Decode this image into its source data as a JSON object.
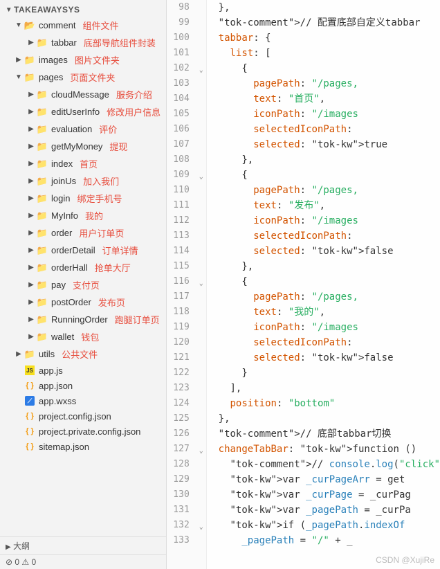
{
  "project_name": "TAKEAWAYSYS",
  "tree": [
    {
      "depth": 1,
      "expand": "open",
      "icon": "folder-open",
      "label": "comment",
      "annotation": "组件文件"
    },
    {
      "depth": 2,
      "expand": "closed",
      "icon": "folder",
      "label": "tabbar",
      "annotation": "底部导航组件封装"
    },
    {
      "depth": 1,
      "expand": "closed",
      "icon": "folder-green",
      "label": "images",
      "annotation": "图片文件夹"
    },
    {
      "depth": 1,
      "expand": "open",
      "icon": "folder-orange",
      "label": "pages",
      "annotation": "页面文件夹"
    },
    {
      "depth": 2,
      "expand": "closed",
      "icon": "folder",
      "label": "cloudMessage",
      "annotation": "服务介绍"
    },
    {
      "depth": 2,
      "expand": "closed",
      "icon": "folder",
      "label": "editUserInfo",
      "annotation": "修改用户信息"
    },
    {
      "depth": 2,
      "expand": "closed",
      "icon": "folder",
      "label": "evaluation",
      "annotation": "评价"
    },
    {
      "depth": 2,
      "expand": "closed",
      "icon": "folder",
      "label": "getMyMoney",
      "annotation": "提现"
    },
    {
      "depth": 2,
      "expand": "closed",
      "icon": "folder",
      "label": "index",
      "annotation": "首页"
    },
    {
      "depth": 2,
      "expand": "closed",
      "icon": "folder",
      "label": "joinUs",
      "annotation": "加入我们"
    },
    {
      "depth": 2,
      "expand": "closed",
      "icon": "folder",
      "label": "login",
      "annotation": "绑定手机号"
    },
    {
      "depth": 2,
      "expand": "closed",
      "icon": "folder",
      "label": "MyInfo",
      "annotation": "我的"
    },
    {
      "depth": 2,
      "expand": "closed",
      "icon": "folder",
      "label": "order",
      "annotation": "用户订单页"
    },
    {
      "depth": 2,
      "expand": "closed",
      "icon": "folder",
      "label": "orderDetail",
      "annotation": "订单详情"
    },
    {
      "depth": 2,
      "expand": "closed",
      "icon": "folder",
      "label": "orderHall",
      "annotation": "抢单大厅"
    },
    {
      "depth": 2,
      "expand": "closed",
      "icon": "folder",
      "label": "pay",
      "annotation": "支付页"
    },
    {
      "depth": 2,
      "expand": "closed",
      "icon": "folder",
      "label": "postOrder",
      "annotation": "发布页"
    },
    {
      "depth": 2,
      "expand": "closed",
      "icon": "folder",
      "label": "RunningOrder",
      "annotation": "跑腿订单页"
    },
    {
      "depth": 2,
      "expand": "closed",
      "icon": "folder",
      "label": "wallet",
      "annotation": "钱包"
    },
    {
      "depth": 1,
      "expand": "closed",
      "icon": "folder-purple",
      "label": "utils",
      "annotation": "公共文件"
    },
    {
      "depth": 1,
      "expand": "",
      "icon": "js",
      "label": "app.js",
      "annotation": ""
    },
    {
      "depth": 1,
      "expand": "",
      "icon": "json",
      "label": "app.json",
      "annotation": ""
    },
    {
      "depth": 1,
      "expand": "",
      "icon": "wxss",
      "label": "app.wxss",
      "annotation": ""
    },
    {
      "depth": 1,
      "expand": "",
      "icon": "json",
      "label": "project.config.json",
      "annotation": ""
    },
    {
      "depth": 1,
      "expand": "",
      "icon": "json",
      "label": "project.private.config.json",
      "annotation": ""
    },
    {
      "depth": 1,
      "expand": "",
      "icon": "json",
      "label": "sitemap.json",
      "annotation": ""
    }
  ],
  "outline_label": "大纲",
  "status_text": "⊘ 0 ⚠ 0",
  "gutter": [
    {
      "n": "98"
    },
    {
      "n": "99"
    },
    {
      "n": "100"
    },
    {
      "n": "101"
    },
    {
      "n": "102",
      "fold": true
    },
    {
      "n": "103"
    },
    {
      "n": "104"
    },
    {
      "n": "105"
    },
    {
      "n": "106"
    },
    {
      "n": "107"
    },
    {
      "n": "108"
    },
    {
      "n": "109",
      "fold": true
    },
    {
      "n": "110"
    },
    {
      "n": "111"
    },
    {
      "n": "112"
    },
    {
      "n": "113"
    },
    {
      "n": "114"
    },
    {
      "n": "115"
    },
    {
      "n": "116",
      "fold": true
    },
    {
      "n": "117"
    },
    {
      "n": "118"
    },
    {
      "n": "119"
    },
    {
      "n": "120"
    },
    {
      "n": "121"
    },
    {
      "n": "122"
    },
    {
      "n": "123"
    },
    {
      "n": "124"
    },
    {
      "n": "125"
    },
    {
      "n": "126"
    },
    {
      "n": "127",
      "fold": true
    },
    {
      "n": "128"
    },
    {
      "n": "129"
    },
    {
      "n": "130"
    },
    {
      "n": "131"
    },
    {
      "n": "132",
      "fold": true
    },
    {
      "n": "133"
    }
  ],
  "code": [
    "  },",
    "  // 配置底部自定义tabbar",
    "  tabbar: {",
    "    list: [",
    "      {",
    "        pagePath: \"/pages,",
    "        text: \"首页\",",
    "        iconPath: \"/images",
    "        selectedIconPath:",
    "        selected: true",
    "      },",
    "      {",
    "        pagePath: \"/pages,",
    "        text: \"发布\",",
    "        iconPath: \"/images",
    "        selectedIconPath:",
    "        selected: false",
    "      },",
    "      {",
    "        pagePath: \"/pages,",
    "        text: \"我的\",",
    "        iconPath: \"/images",
    "        selectedIconPath:",
    "        selected: false",
    "      }",
    "    ],",
    "    position: \"bottom\"",
    "  },",
    "  // 底部tabbar切换",
    "  changeTabBar: function ()",
    "    // console.log(\"click\"",
    "    var _curPageArr = get",
    "    var _curPage = _curPag",
    "    var _pagePath = _curPa",
    "    if (_pagePath.indexOf",
    "      _pagePath = \"/\" + _"
  ],
  "watermark": "CSDN @XujiRe"
}
